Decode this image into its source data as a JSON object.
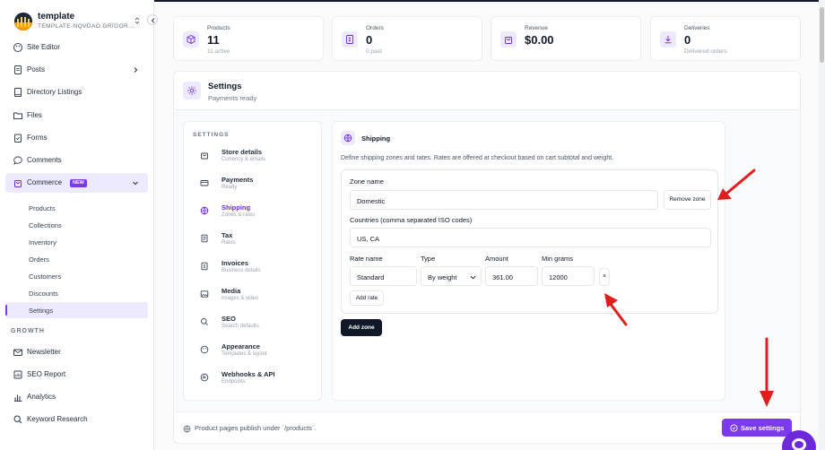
{
  "brand": {
    "title": "template",
    "subtitle": "TEMPLATE-NQVDAO.GRIGOR..."
  },
  "sidebar": {
    "items": [
      {
        "label": "Site Editor"
      },
      {
        "label": "Posts"
      },
      {
        "label": "Directory Listings"
      },
      {
        "label": "Files"
      },
      {
        "label": "Forms"
      },
      {
        "label": "Comments"
      },
      {
        "label": "Commerce",
        "badge": "NEW"
      }
    ],
    "commerce_sub": [
      "Products",
      "Collections",
      "Inventory",
      "Orders",
      "Customers",
      "Discounts",
      "Settings"
    ],
    "growth_label": "GROWTH",
    "growth_items": [
      {
        "label": "Newsletter"
      },
      {
        "label": "SEO Report"
      },
      {
        "label": "Analytics"
      },
      {
        "label": "Keyword Research"
      }
    ]
  },
  "stats": [
    {
      "label": "Products",
      "value": "11",
      "sub": "11 active"
    },
    {
      "label": "Orders",
      "value": "0",
      "sub": "0 paid"
    },
    {
      "label": "Revenue",
      "value": "$0.00",
      "sub": ""
    },
    {
      "label": "Deliveries",
      "value": "0",
      "sub": "Delivered orders"
    }
  ],
  "settings": {
    "title": "Settings",
    "subtitle": "Payments ready",
    "nav_heading": "SETTINGS"
  },
  "settings_nav": [
    {
      "title": "Store details",
      "sub": "Currency & emails"
    },
    {
      "title": "Payments",
      "sub": "Ready"
    },
    {
      "title": "Shipping",
      "sub": "Zones & rates"
    },
    {
      "title": "Tax",
      "sub": "Rates"
    },
    {
      "title": "Invoices",
      "sub": "Business details"
    },
    {
      "title": "Media",
      "sub": "Images & video"
    },
    {
      "title": "SEO",
      "sub": "Search defaults"
    },
    {
      "title": "Appearance",
      "sub": "Templates & layout"
    },
    {
      "title": "Webhooks & API",
      "sub": "Endpoints"
    }
  ],
  "shipping": {
    "title": "Shipping",
    "description": "Define shipping zones and rates. Rates are offered at checkout based on cart subtotal and weight.",
    "zone_name_label": "Zone name",
    "zone_name_value": "Domestic",
    "remove_zone": "Remove zone",
    "countries_label": "Countries (comma separated ISO codes)",
    "countries_value": "US, CA",
    "rate_headers": {
      "name": "Rate name",
      "type": "Type",
      "amount": "Amount",
      "min_grams": "Min grams"
    },
    "rate": {
      "name": "Standard",
      "type": "By weight",
      "amount": "361.00",
      "min_grams": "12000",
      "remove": "×"
    },
    "add_rate": "Add rate",
    "add_zone": "Add zone"
  },
  "footer": {
    "text": "Product pages publish under `/products`.",
    "save": "Save settings"
  },
  "colors": {
    "accent": "#7c3aed",
    "accent_soft": "#ede9fe",
    "annotation": "#e11d1d"
  }
}
